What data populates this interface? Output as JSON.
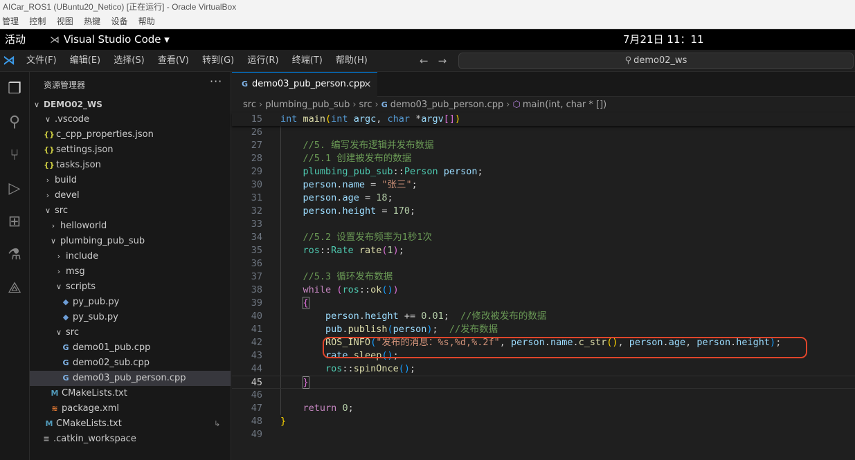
{
  "vbox": {
    "title": "AICar_ROS1 (UBuntu20_Netico) [正在运行] - Oracle VirtualBox",
    "menu": [
      "管理",
      "控制",
      "视图",
      "热键",
      "设备",
      "帮助"
    ]
  },
  "gnome": {
    "activities": "活动",
    "app_name": "Visual Studio Code",
    "app_arrow": "▾",
    "clock": "7月21日  11：11"
  },
  "vscode": {
    "menu": [
      "文件(F)",
      "编辑(E)",
      "选择(S)",
      "查看(V)",
      "转到(G)",
      "运行(R)",
      "终端(T)",
      "帮助(H)"
    ],
    "search": "demo02_ws"
  },
  "sidebar": {
    "header": "资源管理器",
    "more": "···",
    "tree": [
      {
        "label": "DEMO02_WS",
        "chevron": "∨",
        "icon": "",
        "type": "root"
      },
      {
        "label": ".vscode",
        "chevron": "∨",
        "icon": "",
        "type": "folder"
      },
      {
        "label": "c_cpp_properties.json",
        "chevron": "",
        "icon": "{}",
        "type": "json"
      },
      {
        "label": "settings.json",
        "chevron": "",
        "icon": "{}",
        "type": "json"
      },
      {
        "label": "tasks.json",
        "chevron": "",
        "icon": "{}",
        "type": "json"
      },
      {
        "label": "build",
        "chevron": "›",
        "icon": "",
        "type": "folder"
      },
      {
        "label": "devel",
        "chevron": "›",
        "icon": "",
        "type": "folder"
      },
      {
        "label": "src",
        "chevron": "∨",
        "icon": "",
        "type": "folder"
      },
      {
        "label": "helloworld",
        "chevron": "›",
        "icon": "",
        "type": "folder"
      },
      {
        "label": "plumbing_pub_sub",
        "chevron": "∨",
        "icon": "",
        "type": "folder"
      },
      {
        "label": "include",
        "chevron": "›",
        "icon": "",
        "type": "folder"
      },
      {
        "label": "msg",
        "chevron": "›",
        "icon": "",
        "type": "folder"
      },
      {
        "label": "scripts",
        "chevron": "∨",
        "icon": "",
        "type": "folder"
      },
      {
        "label": "py_pub.py",
        "chevron": "",
        "icon": "◆",
        "type": "py"
      },
      {
        "label": "py_sub.py",
        "chevron": "",
        "icon": "◆",
        "type": "py"
      },
      {
        "label": "src",
        "chevron": "∨",
        "icon": "",
        "type": "folder"
      },
      {
        "label": "demo01_pub.cpp",
        "chevron": "",
        "icon": "G",
        "type": "cpp"
      },
      {
        "label": "demo02_sub.cpp",
        "chevron": "",
        "icon": "G",
        "type": "cpp"
      },
      {
        "label": "demo03_pub_person.cpp",
        "chevron": "",
        "icon": "G",
        "type": "cpp"
      },
      {
        "label": "CMakeLists.txt",
        "chevron": "",
        "icon": "M",
        "type": "cmake"
      },
      {
        "label": "package.xml",
        "chevron": "",
        "icon": "≋",
        "type": "xml"
      },
      {
        "label": "CMakeLists.txt",
        "chevron": "",
        "icon": "M",
        "type": "cmake",
        "badge": "↳"
      },
      {
        "label": ".catkin_workspace",
        "chevron": "",
        "icon": "≡",
        "type": "txt"
      }
    ]
  },
  "editor": {
    "tab": {
      "label": "demo03_pub_person.cpp",
      "icon": "G",
      "close": "×"
    },
    "breadcrumb": {
      "parts": [
        "src",
        "plumbing_pub_sub",
        "src",
        "demo03_pub_person.cpp",
        "main(int, char * [])"
      ],
      "sep": "›",
      "file_icon": "G",
      "symbol_icon": "⬡"
    },
    "sticky": {
      "num": "15",
      "tokens": [
        [
          "kw",
          "int "
        ],
        [
          "fn",
          "main"
        ],
        [
          "br1",
          "("
        ],
        [
          "kw",
          "int "
        ],
        [
          "var",
          "argc"
        ],
        [
          "",
          ","
        ],
        [
          "kw",
          " char "
        ],
        [
          "",
          "*"
        ],
        [
          "var",
          "argv"
        ],
        [
          "br2",
          "[]"
        ],
        [
          "br1",
          ")"
        ]
      ]
    },
    "lines": [
      {
        "num": "26",
        "tokens": []
      },
      {
        "num": "27",
        "tokens": [
          [
            "",
            "    "
          ],
          [
            "cm",
            "//5. 编写发布逻辑并发布数据"
          ]
        ]
      },
      {
        "num": "28",
        "tokens": [
          [
            "",
            "    "
          ],
          [
            "cm",
            "//5.1 创建被发布的数据"
          ]
        ]
      },
      {
        "num": "29",
        "tokens": [
          [
            "",
            "    "
          ],
          [
            "ty",
            "plumbing_pub_sub"
          ],
          [
            "",
            "::"
          ],
          [
            "ty",
            "Person"
          ],
          [
            "",
            " "
          ],
          [
            "var",
            "person"
          ],
          [
            "",
            ";"
          ]
        ]
      },
      {
        "num": "30",
        "tokens": [
          [
            "",
            "    "
          ],
          [
            "var",
            "person"
          ],
          [
            "",
            "."
          ],
          [
            "var",
            "name"
          ],
          [
            "",
            " = "
          ],
          [
            "str",
            "\"张三\""
          ],
          [
            "",
            ";"
          ]
        ]
      },
      {
        "num": "31",
        "tokens": [
          [
            "",
            "    "
          ],
          [
            "var",
            "person"
          ],
          [
            "",
            "."
          ],
          [
            "var",
            "age"
          ],
          [
            "",
            " = "
          ],
          [
            "num",
            "18"
          ],
          [
            "",
            ";"
          ]
        ]
      },
      {
        "num": "32",
        "tokens": [
          [
            "",
            "    "
          ],
          [
            "var",
            "person"
          ],
          [
            "",
            "."
          ],
          [
            "var",
            "height"
          ],
          [
            "",
            " = "
          ],
          [
            "num",
            "170"
          ],
          [
            "",
            ";"
          ]
        ]
      },
      {
        "num": "33",
        "tokens": []
      },
      {
        "num": "34",
        "tokens": [
          [
            "",
            "    "
          ],
          [
            "cm",
            "//5.2 设置发布频率为1秒1次"
          ]
        ]
      },
      {
        "num": "35",
        "tokens": [
          [
            "",
            "    "
          ],
          [
            "ty",
            "ros"
          ],
          [
            "",
            "::"
          ],
          [
            "ty",
            "Rate"
          ],
          [
            "",
            " "
          ],
          [
            "fn",
            "rate"
          ],
          [
            "br2",
            "("
          ],
          [
            "num",
            "1"
          ],
          [
            "br2",
            ")"
          ],
          [
            "",
            ";"
          ]
        ]
      },
      {
        "num": "36",
        "tokens": []
      },
      {
        "num": "37",
        "tokens": [
          [
            "",
            "    "
          ],
          [
            "cm",
            "//5.3 循环发布数据"
          ]
        ]
      },
      {
        "num": "38",
        "tokens": [
          [
            "",
            "    "
          ],
          [
            "ctl",
            "while"
          ],
          [
            "",
            " "
          ],
          [
            "br2",
            "("
          ],
          [
            "ty",
            "ros"
          ],
          [
            "",
            "::"
          ],
          [
            "fn",
            "ok"
          ],
          [
            "br3",
            "()"
          ],
          [
            "br2",
            ")"
          ]
        ]
      },
      {
        "num": "39",
        "tokens": [
          [
            "",
            "    "
          ],
          [
            "br2 bm",
            "{"
          ]
        ]
      },
      {
        "num": "40",
        "tokens": [
          [
            "",
            "        "
          ],
          [
            "var",
            "person"
          ],
          [
            "",
            "."
          ],
          [
            "var",
            "height"
          ],
          [
            "",
            " += "
          ],
          [
            "num",
            "0.01"
          ],
          [
            "",
            ";  "
          ],
          [
            "cm",
            "//修改被发布的数据"
          ]
        ]
      },
      {
        "num": "41",
        "tokens": [
          [
            "",
            "        "
          ],
          [
            "var",
            "pub"
          ],
          [
            "",
            "."
          ],
          [
            "fn",
            "publish"
          ],
          [
            "br3",
            "("
          ],
          [
            "var",
            "person"
          ],
          [
            "br3",
            ")"
          ],
          [
            "",
            ";  "
          ],
          [
            "cm",
            "//发布数据"
          ]
        ]
      },
      {
        "num": "42",
        "tokens": [
          [
            "",
            "        "
          ],
          [
            "fn",
            "ROS_INFO"
          ],
          [
            "br3",
            "("
          ],
          [
            "str",
            "\"发布的消息：%s,%d,%.2f\""
          ],
          [
            "",
            ", "
          ],
          [
            "var",
            "person"
          ],
          [
            "",
            "."
          ],
          [
            "var",
            "name"
          ],
          [
            "",
            "."
          ],
          [
            "fn",
            "c_str"
          ],
          [
            "br1",
            "()"
          ],
          [
            "",
            ", "
          ],
          [
            "var",
            "person"
          ],
          [
            "",
            "."
          ],
          [
            "var",
            "age"
          ],
          [
            "",
            ", "
          ],
          [
            "var",
            "person"
          ],
          [
            "",
            "."
          ],
          [
            "var",
            "height"
          ],
          [
            "br3",
            ")"
          ],
          [
            "",
            ";"
          ]
        ]
      },
      {
        "num": "43",
        "tokens": [
          [
            "",
            "        "
          ],
          [
            "var",
            "rate"
          ],
          [
            "",
            "."
          ],
          [
            "fn",
            "sleep"
          ],
          [
            "br3",
            "()"
          ],
          [
            "",
            ";"
          ]
        ]
      },
      {
        "num": "44",
        "tokens": [
          [
            "",
            "        "
          ],
          [
            "ty",
            "ros"
          ],
          [
            "",
            "::"
          ],
          [
            "fn",
            "spinOnce"
          ],
          [
            "br3",
            "()"
          ],
          [
            "",
            ";"
          ]
        ]
      },
      {
        "num": "45",
        "tokens": [
          [
            "",
            "    "
          ],
          [
            "br2 bm",
            "}"
          ]
        ],
        "current": true
      },
      {
        "num": "46",
        "tokens": []
      },
      {
        "num": "47",
        "tokens": [
          [
            "",
            "    "
          ],
          [
            "ctl",
            "return"
          ],
          [
            "",
            " "
          ],
          [
            "num",
            "0"
          ],
          [
            "",
            ";"
          ]
        ]
      },
      {
        "num": "48",
        "tokens": [
          [
            "br1",
            "}"
          ]
        ]
      },
      {
        "num": "49",
        "tokens": []
      }
    ]
  },
  "colors": {
    "accent": "#0078d4",
    "annotation": "#e0452b",
    "editor_bg": "#1f1f1f",
    "sidebar_bg": "#181818"
  }
}
